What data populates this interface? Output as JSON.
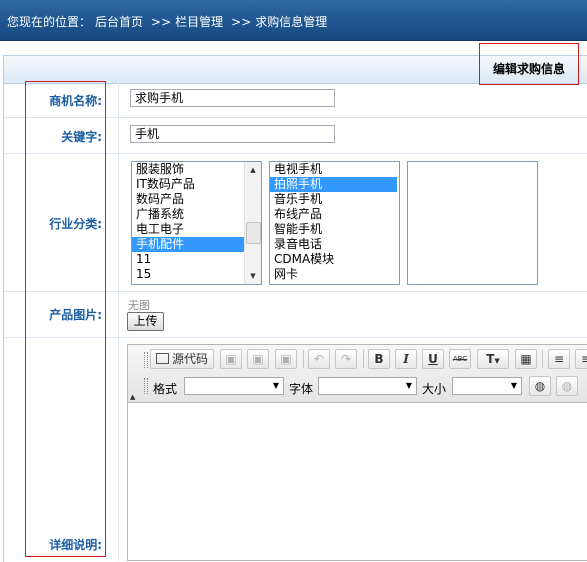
{
  "breadcrumb": {
    "prefix": "您现在的位置：",
    "items": [
      "后台首页",
      "栏目管理",
      "求购信息管理"
    ],
    "separator": ">>"
  },
  "panel": {
    "title": "编辑求购信息"
  },
  "fields": {
    "name_label": "商机名称:",
    "name_value": "求购手机",
    "keyword_label": "关键字:",
    "keyword_value": "手机",
    "industry_label": "行业分类:",
    "image_label": "产品图片:",
    "image_empty": "无图",
    "upload_button": "上传",
    "detail_label": "详细说明:"
  },
  "industry": {
    "level1": [
      "服装服饰",
      "IT数码产品",
      "数码产品",
      "广播系统",
      "电工电子",
      "手机配件",
      "11",
      "15"
    ],
    "level1_selected": "手机配件",
    "level2": [
      "电视手机",
      "拍照手机",
      "音乐手机",
      "布线产品",
      "智能手机",
      "录音电话",
      "CDMA模块",
      "网卡"
    ],
    "level2_selected": "拍照手机",
    "level3": []
  },
  "editor": {
    "source_label": "源代码",
    "format_label": "格式",
    "font_label": "字体",
    "size_label": "大小",
    "icons": [
      "source-icon",
      "cut-icon",
      "copy-icon",
      "paste-icon",
      "undo-icon",
      "redo-icon",
      "bold-icon",
      "italic-icon",
      "underline-icon",
      "strikethrough-icon",
      "text-color-icon",
      "table-icon",
      "align-icon",
      "link-icon",
      "unlink-icon"
    ],
    "toolbar_glyphs": {
      "bold": "B",
      "italic": "I",
      "underline": "U",
      "strike": "ABC",
      "text_color": "T"
    }
  },
  "colors": {
    "header_bg": "#1f5590",
    "label_text": "#1d5ea3",
    "selection": "#3399ff",
    "highlight_frame": "#d21c1c"
  }
}
